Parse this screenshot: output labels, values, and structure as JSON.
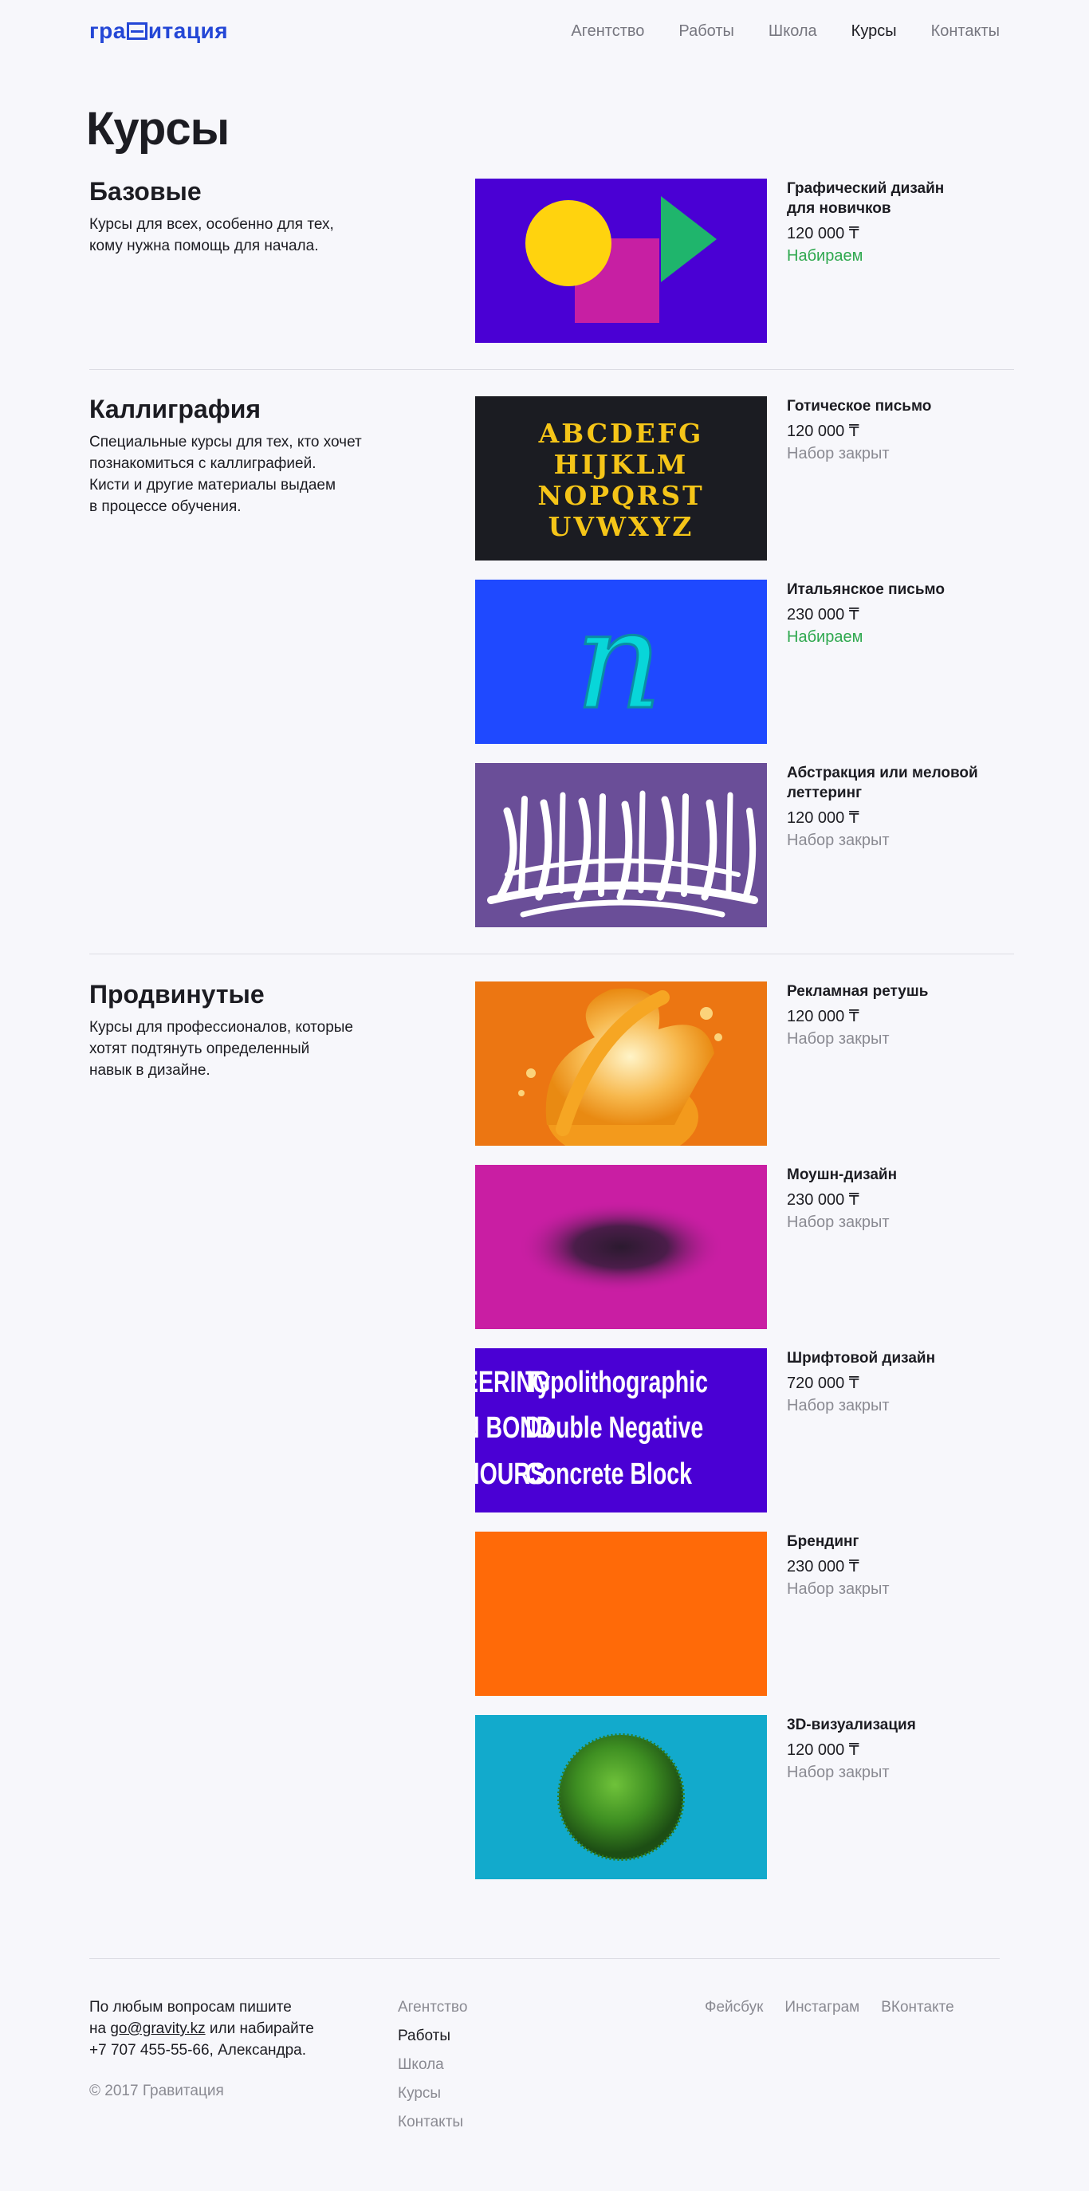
{
  "header": {
    "logo_text": "гравитация",
    "nav": [
      {
        "label": "Агентство",
        "active": false
      },
      {
        "label": "Работы",
        "active": false
      },
      {
        "label": "Школа",
        "active": false
      },
      {
        "label": "Курсы",
        "active": true
      },
      {
        "label": "Контакты",
        "active": false
      }
    ]
  },
  "page_title": "Курсы",
  "sections": [
    {
      "title": "Базовые",
      "description": "Курсы для всех, особенно для тех,\nкому нужна помощь для начала.",
      "courses": [
        {
          "name": "Графический дизайн\nдля новичков",
          "price": "120 000 ₸",
          "status": "Набираем",
          "open": true,
          "image": "shapes-image"
        }
      ]
    },
    {
      "title": "Каллиграфия",
      "description": "Специальные курсы для тех, кто хочет\nпознакомиться с каллиграфией.\nКисти и другие материалы выдаем\nв процессе обучения.",
      "courses": [
        {
          "name": "Готическое письмо",
          "price": "120 000 ₸",
          "status": "Набор закрыт",
          "open": false,
          "image": "gothic-letters-image"
        },
        {
          "name": "Итальянское письмо",
          "price": "230 000 ₸",
          "status": "Набираем",
          "open": true,
          "image": "italic-n-image"
        },
        {
          "name": "Абстракция или меловой леттеринг",
          "price": "120 000 ₸",
          "status": "Набор закрыт",
          "open": false,
          "image": "arabic-calligraphy-image"
        }
      ]
    },
    {
      "title": "Продвинутые",
      "description": "Курсы для профессионалов, которые\nхотят подтянуть определенный\nнавык в дизайне.",
      "courses": [
        {
          "name": "Рекламная ретушь",
          "price": "120 000 ₸",
          "status": "Набор закрыт",
          "open": false,
          "image": "orange-splash-image"
        },
        {
          "name": "Моушн-дизайн",
          "price": "230 000 ₸",
          "status": "Набор закрыт",
          "open": false,
          "image": "blur-blob-image"
        },
        {
          "name": "Шрифтовой дизайн",
          "price": "720 000 ₸",
          "status": "Набор закрыт",
          "open": false,
          "image": "typography-image"
        },
        {
          "name": "Брендинг",
          "price": "230 000 ₸",
          "status": "Набор закрыт",
          "open": false,
          "image": "orange-block-image"
        },
        {
          "name": "3D-визуализация",
          "price": "120 000 ₸",
          "status": "Набор закрыт",
          "open": false,
          "image": "grass-sphere-image"
        }
      ]
    }
  ],
  "images": {
    "gothic_rows": [
      "ABCDEFG",
      "HIJKLM",
      "NOPQRST",
      "UVWXYZ"
    ],
    "italic_letter": "n",
    "type_samples": [
      {
        "left": "EERING",
        "right": "Typolithographic"
      },
      {
        "left": "N BOND",
        "right": "Double Negative"
      },
      {
        "left": "HOURS",
        "right": "Concrete Block"
      }
    ]
  },
  "footer": {
    "contact_line1": "По любым вопросам пишите",
    "contact_prefix": "на ",
    "email": "go@gravity.kz",
    "contact_suffix": " или набирайте",
    "contact_line3": "+7 707 455-55-66, Александра.",
    "copyright": "© 2017 Гравитация",
    "nav": [
      {
        "label": "Агентство",
        "active": false
      },
      {
        "label": "Работы",
        "active": true
      },
      {
        "label": "Школа",
        "active": false
      },
      {
        "label": "Курсы",
        "active": false
      },
      {
        "label": "Контакты",
        "active": false
      }
    ],
    "social": [
      "Фейсбук",
      "Инстаграм",
      "ВКонтакте"
    ]
  },
  "colors": {
    "accent_blue": "#2447d6",
    "status_open": "#2fa84f",
    "status_closed": "#8a8a92",
    "background": "#f7f7fb"
  }
}
